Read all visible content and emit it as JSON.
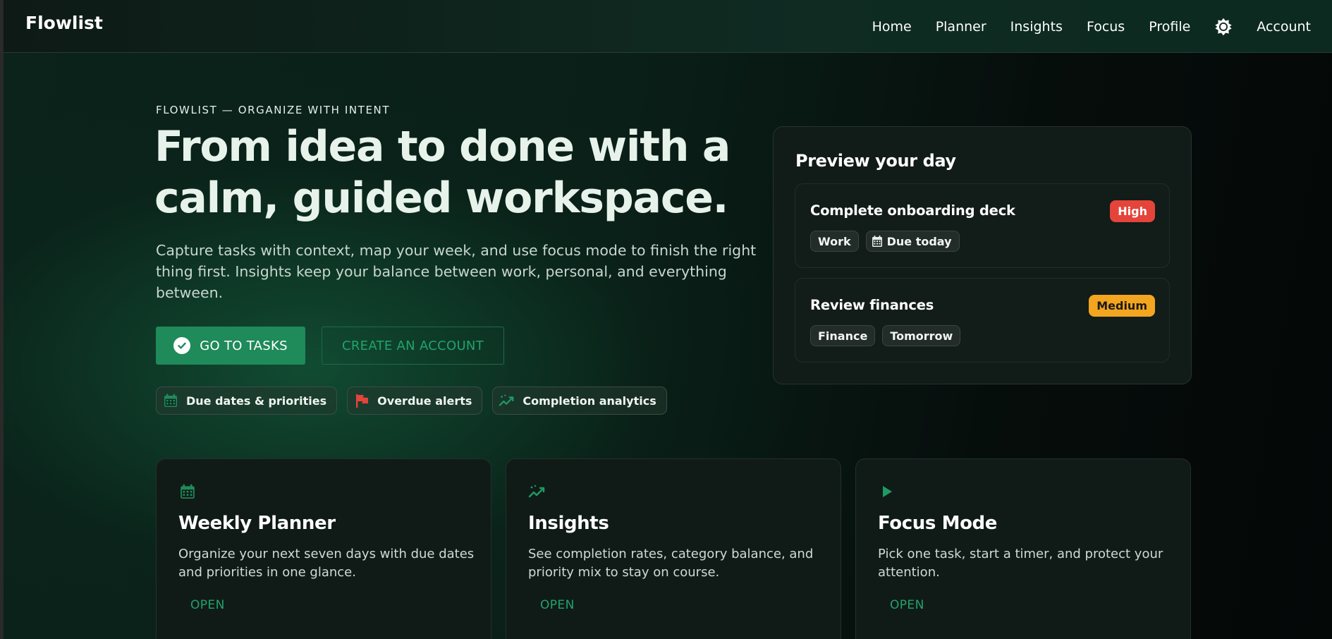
{
  "nav": {
    "brand": "Flowlist",
    "links": [
      "Home",
      "Planner",
      "Insights",
      "Focus",
      "Profile"
    ],
    "theme_icon": "brightness-icon",
    "account": "Account"
  },
  "hero": {
    "eyebrow": "FLOWLIST — ORGANIZE WITH INTENT",
    "headline_line1": "From idea to done with a",
    "headline_line2": "calm, guided workspace.",
    "lede": "Capture tasks with context, map your week, and use focus mode to finish the right thing first. Insights keep your balance between work, personal, and everything between.",
    "primary_button": "GO TO TASKS",
    "secondary_button": "CREATE AN ACCOUNT",
    "chips": [
      {
        "label": "Due dates & priorities",
        "icon": "calendar-icon"
      },
      {
        "label": "Overdue alerts",
        "icon": "flag-icon"
      },
      {
        "label": "Completion analytics",
        "icon": "trending-icon"
      }
    ]
  },
  "preview": {
    "title": "Preview your day",
    "tasks": [
      {
        "title": "Complete onboarding deck",
        "priority": "High",
        "tags": [
          "Work",
          "Due today"
        ]
      },
      {
        "title": "Review finances",
        "priority": "Medium",
        "tags": [
          "Finance",
          "Tomorrow"
        ]
      }
    ]
  },
  "features": [
    {
      "icon": "calendar-icon",
      "title": "Weekly Planner",
      "desc": "Organize your next seven days with due dates and priorities in one glance.",
      "link": "OPEN"
    },
    {
      "icon": "trending-icon",
      "title": "Insights",
      "desc": "See completion rates, category balance, and priority mix to stay on course.",
      "link": "OPEN"
    },
    {
      "icon": "play-icon",
      "title": "Focus Mode",
      "desc": "Pick one task, start a timer, and protect your attention.",
      "link": "OPEN"
    }
  ],
  "colors": {
    "accent": "#1f8a5a",
    "accent_text": "#22a36b",
    "high": "#e5443a",
    "medium": "#f2a51f"
  }
}
